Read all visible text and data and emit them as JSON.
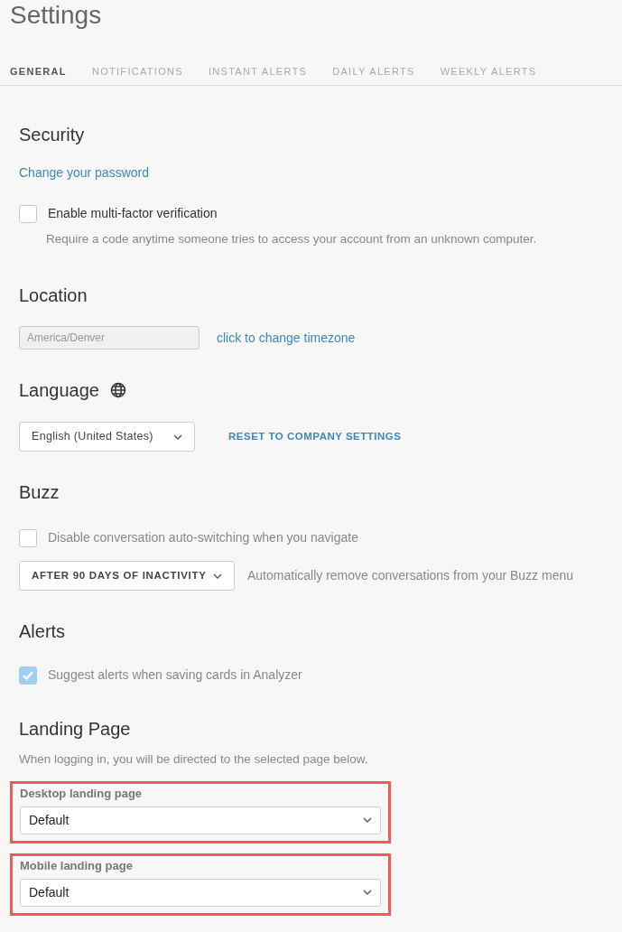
{
  "title": "Settings",
  "tabs": [
    {
      "label": "GENERAL",
      "selected": true
    },
    {
      "label": "NOTIFICATIONS",
      "selected": false
    },
    {
      "label": "INSTANT ALERTS",
      "selected": false
    },
    {
      "label": "DAILY ALERTS",
      "selected": false
    },
    {
      "label": "WEEKLY ALERTS",
      "selected": false
    }
  ],
  "security": {
    "heading": "Security",
    "link": "Change your password",
    "mfa": {
      "label": "Enable multi-factor verification",
      "checked": false,
      "description": "Require a code anytime someone tries to access your account from an unknown computer."
    }
  },
  "location": {
    "heading": "Location",
    "timezone": {
      "value": "America/Denver"
    },
    "link": "click to change timezone"
  },
  "language": {
    "heading": "Language",
    "select": {
      "value": "English (United States)"
    },
    "reset": "RESET TO COMPANY SETTINGS"
  },
  "buzz": {
    "heading": "Buzz",
    "checkbox": {
      "label": "Disable conversation auto-switching when you navigate",
      "checked": false
    },
    "select": {
      "value": "AFTER 90 DAYS OF INACTIVITY"
    },
    "description": "Automatically remove conversations from your Buzz menu"
  },
  "alerts": {
    "heading": "Alerts",
    "checkbox": {
      "label": "Suggest alerts when saving cards in Analyzer",
      "checked": true
    }
  },
  "landing_page": {
    "heading": "Landing Page",
    "description": "When logging in, you will be directed to the selected page below.",
    "fields": [
      {
        "label": "Desktop landing page",
        "value": "Default",
        "highlighted": true
      },
      {
        "label": "Mobile landing page",
        "value": "Default",
        "highlighted": true
      }
    ]
  }
}
